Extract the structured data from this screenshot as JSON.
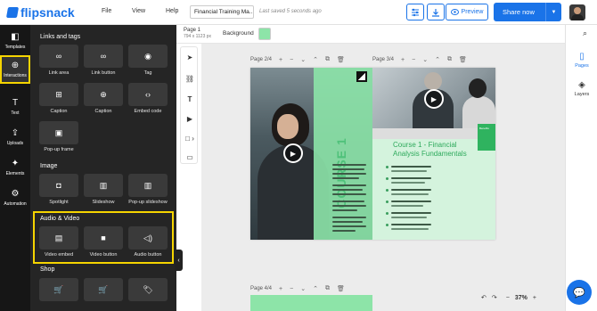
{
  "app": {
    "logo": "flipsnack"
  },
  "menu": {
    "file": "File",
    "view": "View",
    "help": "Help"
  },
  "document": {
    "name": "Financial Training Ma...",
    "saved_status": "Last saved 5 seconds ago"
  },
  "toolbar": {
    "preview": "Preview",
    "share": "Share now"
  },
  "rail": [
    {
      "label": "Templates",
      "icon": "layout-icon",
      "glyph": "◧"
    },
    {
      "label": "Interactions",
      "icon": "interactions-icon",
      "glyph": "⊕"
    },
    {
      "label": "Text",
      "icon": "text-icon",
      "glyph": "T"
    },
    {
      "label": "Uploads",
      "icon": "upload-icon",
      "glyph": "⇪"
    },
    {
      "label": "Elements",
      "icon": "elements-icon",
      "glyph": "✦"
    },
    {
      "label": "Automation",
      "icon": "automation-icon",
      "glyph": "⚙"
    }
  ],
  "panel": {
    "links_title": "Links and tags",
    "links": [
      {
        "label": "Link area",
        "glyph": "∞"
      },
      {
        "label": "Link button",
        "glyph": "∞"
      },
      {
        "label": "Tag",
        "glyph": "◉"
      },
      {
        "label": "Caption",
        "glyph": "⊞"
      },
      {
        "label": "Caption",
        "glyph": "⊕"
      },
      {
        "label": "Embed code",
        "glyph": "‹›"
      },
      {
        "label": "Pop-up frame",
        "glyph": "▣"
      }
    ],
    "image_title": "Image",
    "image": [
      {
        "label": "Spotlight",
        "glyph": "◘"
      },
      {
        "label": "Slideshow",
        "glyph": "▥"
      },
      {
        "label": "Pop-up slideshow",
        "glyph": "▥"
      }
    ],
    "av_title": "Audio & Video",
    "av": [
      {
        "label": "Video embed",
        "glyph": "▤"
      },
      {
        "label": "Video button",
        "glyph": "■"
      },
      {
        "label": "Audio button",
        "glyph": "◁)"
      }
    ],
    "shop_title": "Shop",
    "shop": [
      {
        "glyph": "🛒"
      },
      {
        "glyph": "🛒"
      },
      {
        "glyph": "🏷"
      }
    ]
  },
  "subbar": {
    "page": "Page 1",
    "size": "794 x 1123 px",
    "background": "Background",
    "bg_color": "#8de4a8"
  },
  "canvas": {
    "page_left": "Page 2/4",
    "page_right": "Page 3/4",
    "page_next": "Page 4/4",
    "vertical_title": "COURSE 1",
    "course_title_line1": "Course 1 - Financial",
    "course_title_line2": "Analysis Fundamentals",
    "tag_text": "Benefits"
  },
  "right_panel": {
    "pages": "Pages",
    "layers": "Layers"
  },
  "zoom": {
    "value": "37%",
    "minus": "−",
    "plus": "+"
  }
}
